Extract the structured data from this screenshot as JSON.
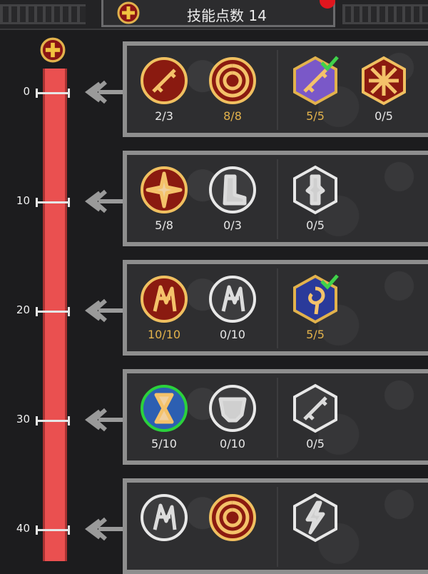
{
  "header": {
    "title": "技能点数 14"
  },
  "level_ticks": [
    "0",
    "10",
    "20",
    "30",
    "40"
  ],
  "rows": [
    {
      "skills": [
        {
          "icon": "sword-skill-icon",
          "count": "2/3",
          "count_color": "white"
        },
        {
          "icon": "target-skill-icon",
          "count": "8/8",
          "count_color": "gold"
        },
        {
          "icon": "purple-blade-skill-icon",
          "count": "5/5",
          "count_color": "gold",
          "checked": true
        },
        {
          "icon": "crossed-swords-skill-icon",
          "count": "0/5",
          "count_color": "white"
        }
      ]
    },
    {
      "skills": [
        {
          "icon": "burst-skill-icon",
          "count": "5/8",
          "count_color": "white"
        },
        {
          "icon": "boot-skill-icon",
          "count": "0/3",
          "count_color": "white"
        },
        {
          "icon": "statue-skill-icon",
          "count": "0/5",
          "count_color": "white"
        }
      ]
    },
    {
      "skills": [
        {
          "icon": "fire-chain-skill-icon",
          "count": "10/10",
          "count_color": "gold"
        },
        {
          "icon": "shattered-skill-icon",
          "count": "0/10",
          "count_color": "white"
        },
        {
          "icon": "rose-shield-skill-icon",
          "count": "5/5",
          "count_color": "gold",
          "checked": true
        }
      ]
    },
    {
      "skills": [
        {
          "icon": "hourglass-skill-icon",
          "count": "5/10",
          "count_color": "white",
          "selected": true
        },
        {
          "icon": "helmet-skill-icon",
          "count": "0/10",
          "count_color": "white"
        },
        {
          "icon": "blade-slash-skill-icon",
          "count": "0/5",
          "count_color": "white"
        }
      ]
    },
    {
      "skills": [
        {
          "icon": "claw-skill-icon",
          "count": "",
          "count_color": "white"
        },
        {
          "icon": "target-skill-icon",
          "count": "",
          "count_color": "gold"
        },
        {
          "icon": "lightning-skill-icon",
          "count": "",
          "count_color": "white"
        }
      ]
    }
  ]
}
